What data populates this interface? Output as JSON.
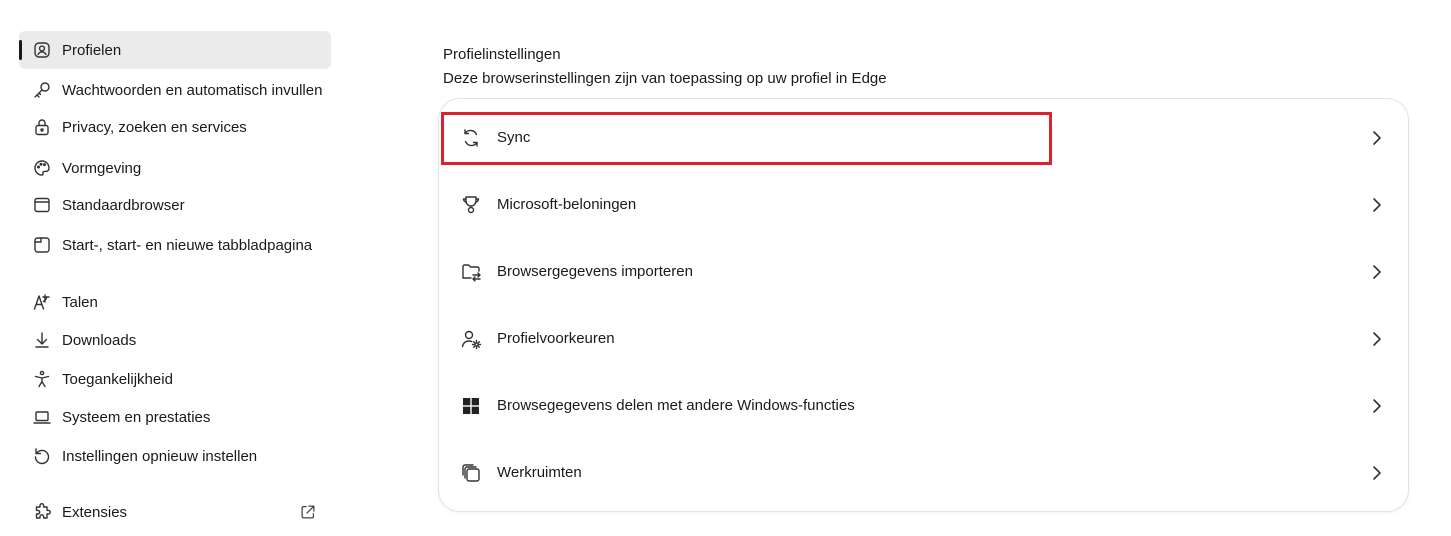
{
  "sidebar": {
    "items": [
      {
        "label": "Profielen",
        "icon": "profile-icon",
        "active": true
      },
      {
        "label": "Wachtwoorden en automatisch invullen",
        "icon": "key-icon"
      },
      {
        "label": "Privacy, zoeken en services",
        "icon": "lock-icon"
      },
      {
        "label": "Vormgeving",
        "icon": "palette-icon"
      },
      {
        "label": "Standaardbrowser",
        "icon": "browser-window-icon"
      },
      {
        "label": "Start-, start- en nieuwe tabbladpagina",
        "icon": "tab-page-icon"
      },
      {
        "label": "Talen",
        "icon": "language-icon"
      },
      {
        "label": "Downloads",
        "icon": "download-icon"
      },
      {
        "label": "Toegankelijkheid",
        "icon": "accessibility-icon"
      },
      {
        "label": "Systeem en prestaties",
        "icon": "laptop-icon"
      },
      {
        "label": "Instellingen opnieuw instellen",
        "icon": "reset-icon"
      },
      {
        "label": "Extensies",
        "icon": "puzzle-icon",
        "external": true
      }
    ]
  },
  "main": {
    "title": "Profielinstellingen",
    "subtitle": "Deze browserinstellingen zijn van toepassing op uw profiel in Edge",
    "rows": [
      {
        "label": "Sync",
        "icon": "sync-icon",
        "highlighted": true
      },
      {
        "label": "Microsoft-beloningen",
        "icon": "trophy-icon"
      },
      {
        "label": "Browsergegevens importeren",
        "icon": "import-folder-icon"
      },
      {
        "label": "Profielvoorkeuren",
        "icon": "profile-settings-icon"
      },
      {
        "label": "Browsegegevens delen met andere Windows-functies",
        "icon": "windows-icon"
      },
      {
        "label": "Werkruimten",
        "icon": "workspaces-icon"
      }
    ]
  },
  "colors": {
    "highlight": "#d9232d",
    "active_bg": "#ebebeb"
  }
}
